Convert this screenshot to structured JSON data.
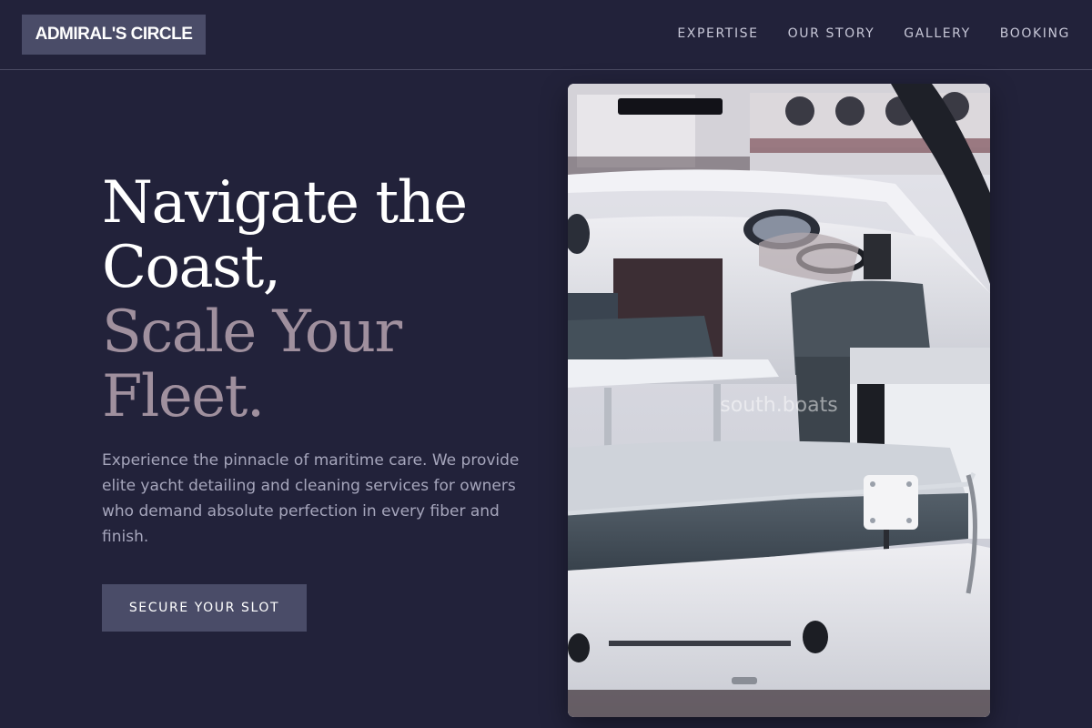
{
  "brand": {
    "name": "ADMIRAL'S CIRCLE"
  },
  "nav": {
    "links": [
      "EXPERTISE",
      "OUR STORY",
      "GALLERY",
      "BOOKING"
    ]
  },
  "hero": {
    "headline_line1": "Navigate the",
    "headline_line2": "Coast,",
    "headline_line3": "Scale Your",
    "headline_line4": "Fleet.",
    "description": "Experience the pinnacle of maritime care. We provide elite yacht detailing and cleaning services for owners who demand absolute perfection in every fiber and finish.",
    "cta_label": "SECURE YOUR SLOT",
    "image_watermark": "south.boats"
  },
  "colors": {
    "background": "#22223a",
    "accent": "#4a4c68",
    "headline_primary": "#ffffff",
    "headline_secondary": "#a0909e",
    "body_text": "#a6a6bc"
  }
}
